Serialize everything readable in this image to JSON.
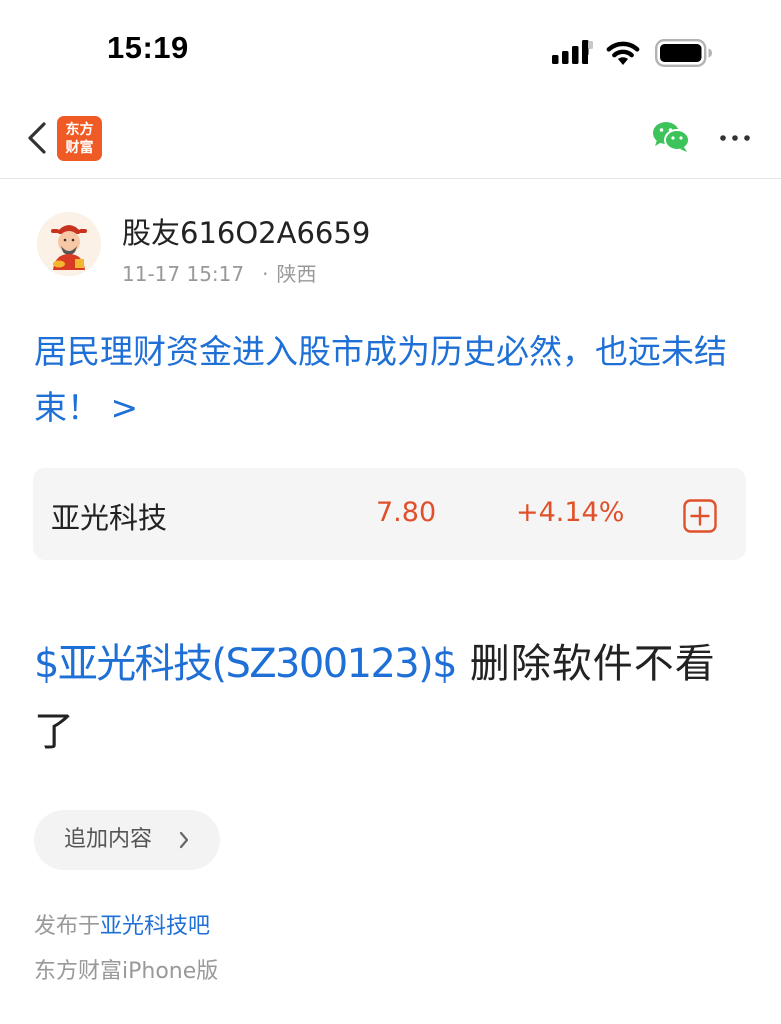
{
  "status": {
    "time": "15:19"
  },
  "nav": {
    "logo_top": "东方",
    "logo_bottom": "财富"
  },
  "author": {
    "name": "股友616O2A6659",
    "date": "11-17 15:17",
    "dot": "·",
    "location": "陕西"
  },
  "headline": {
    "text": "居民理财资金进入股市成为历史必然，也远未结束！ >"
  },
  "stock": {
    "name": "亚光科技",
    "price": "7.80",
    "change": "+4.14%"
  },
  "post": {
    "stock_link": "$亚光科技(SZ300123)$",
    "text": " 删除软件不看了"
  },
  "append": {
    "label": "追加内容",
    "chevron": "›"
  },
  "footer": {
    "publish_prefix": "发布于",
    "forum": "亚光科技吧",
    "client": "东方财富iPhone版"
  },
  "colors": {
    "link": "#1e6fd6",
    "up": "#e0502a",
    "brand": "#f05a24",
    "wechat": "#3cc45a"
  },
  "icons": [
    "signal-icon",
    "wifi-icon",
    "battery-icon",
    "back-icon",
    "wechat-icon",
    "more-icon",
    "add-watchlist-icon",
    "chevron-right-icon"
  ]
}
